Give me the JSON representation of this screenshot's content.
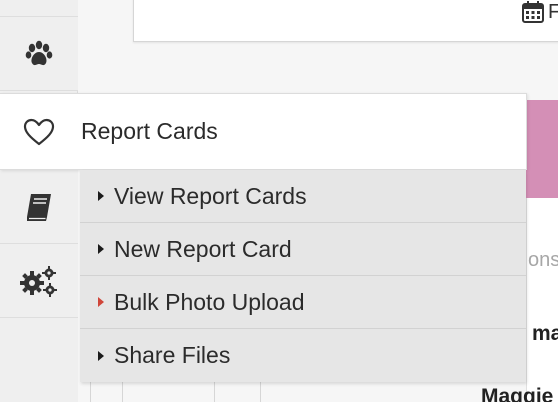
{
  "header_partial": {
    "calendar_label": "F"
  },
  "menu": {
    "title": "Report Cards",
    "items": [
      {
        "label": "View Report Cards",
        "caret_color": "#1b1b1b"
      },
      {
        "label": "New Report Card",
        "caret_color": "#1b1b1b"
      },
      {
        "label": "Bulk Photo Upload",
        "caret_color": "#d0463a"
      },
      {
        "label": "Share Files",
        "caret_color": "#1b1b1b"
      }
    ]
  },
  "background_partial": {
    "text_a": "ons",
    "text_b": "ma",
    "text_c": "Maggie"
  },
  "rail_icons": [
    "paw-icon",
    "heart-icon",
    "book-icon",
    "gears-icon"
  ],
  "colors": {
    "accent_pink": "#d48fb6",
    "active_caret": "#d0463a"
  }
}
